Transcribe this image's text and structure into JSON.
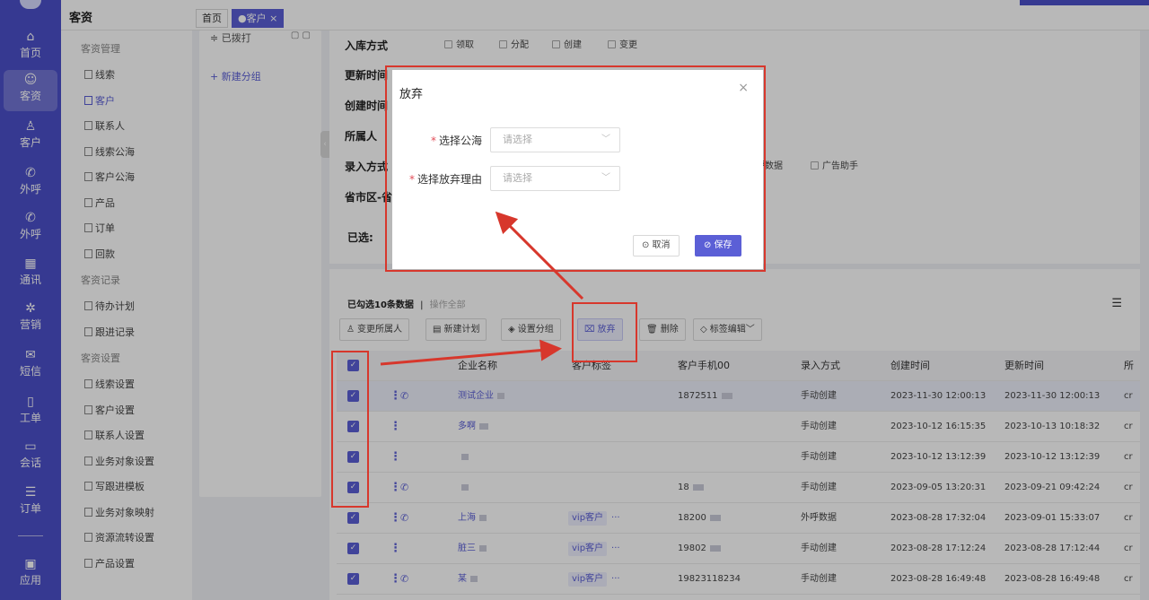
{
  "rail": [
    {
      "label": "首页",
      "icon": "home-icon",
      "glyph": "⌂"
    },
    {
      "label": "客资",
      "icon": "users-icon",
      "glyph": "☺"
    },
    {
      "label": "客户",
      "icon": "person-icon",
      "glyph": "♙"
    },
    {
      "label": "外呼",
      "icon": "phone-out-icon",
      "glyph": "✆"
    },
    {
      "label": "外呼",
      "icon": "phone-out-icon",
      "glyph": "✆"
    },
    {
      "label": "通讯",
      "icon": "contacts-icon",
      "glyph": "▦"
    },
    {
      "label": "营销",
      "icon": "marketing-icon",
      "glyph": "✲"
    },
    {
      "label": "短信",
      "icon": "sms-icon",
      "glyph": "✉"
    },
    {
      "label": "工单",
      "icon": "ticket-icon",
      "glyph": "▯"
    },
    {
      "label": "会话",
      "icon": "chat-icon",
      "glyph": "▭"
    },
    {
      "label": "订单",
      "icon": "order-icon",
      "glyph": "☰"
    },
    {
      "label": "应用",
      "icon": "apps-icon",
      "glyph": "▣"
    }
  ],
  "topbar": {
    "module_title": "客资",
    "tabs": [
      "首页",
      "●客户 ×"
    ]
  },
  "subnav": {
    "groups": [
      {
        "title": "客资管理",
        "items": [
          "线索",
          "客户",
          "联系人",
          "线索公海",
          "客户公海",
          "产品",
          "订单",
          "回款"
        ]
      },
      {
        "title": "客资记录",
        "items": [
          "待办计划",
          "跟进记录"
        ]
      },
      {
        "title": "客资设置",
        "items": [
          "线索设置",
          "客户设置",
          "联系人设置",
          "业务对象设置",
          "写跟进模板",
          "业务对象映射",
          "资源流转设置",
          "产品设置"
        ]
      }
    ],
    "active": "客户"
  },
  "groups_panel": {
    "top_item": "≑ 已拨打",
    "top_icons": "▢ ▢",
    "new_group": "+ 新建分组"
  },
  "filters": {
    "rows": [
      {
        "label": "入库方式",
        "options": [
          "领取",
          "分配",
          "创建",
          "变更"
        ]
      },
      {
        "label": "更新时间",
        "options": []
      },
      {
        "label": "创建时间",
        "options": []
      },
      {
        "label": "所属人",
        "options": []
      },
      {
        "label": "录入方式",
        "options": [
          "呼数据",
          "广告助手"
        ]
      },
      {
        "label": "省市区-省",
        "options": []
      },
      {
        "label": "已选:",
        "options": []
      }
    ]
  },
  "list": {
    "selected_info": "已勾选10条数据",
    "divider": "|",
    "operate_all": "操作全部",
    "toolbar": [
      {
        "label": "变更所属人",
        "icon": "user-change-icon",
        "glyph": "♙"
      },
      {
        "label": "新建计划",
        "icon": "plan-icon",
        "glyph": "▤"
      },
      {
        "label": "设置分组",
        "icon": "layers-icon",
        "glyph": "◈"
      },
      {
        "label": "放弃",
        "icon": "abandon-icon",
        "glyph": "⌧"
      },
      {
        "label": "删除",
        "icon": "trash-icon",
        "glyph": "🗑"
      },
      {
        "label": "标签编辑﹀",
        "icon": "tag-icon",
        "glyph": "◇"
      }
    ],
    "columns": [
      "企业名称",
      "客户标签",
      "客户手机00",
      "录入方式",
      "创建时间",
      "更新时间",
      "所"
    ],
    "rows": [
      {
        "name": "测试企业",
        "tag": "",
        "phone": "1872511",
        "entry": "手动创建",
        "created": "2023-11-30 12:00:13",
        "updated": "2023-11-30 12:00:13",
        "owner": "cr",
        "call": true
      },
      {
        "name": "多啊",
        "tag": "",
        "phone": "",
        "entry": "手动创建",
        "created": "2023-10-12 16:15:35",
        "updated": "2023-10-13 10:18:32",
        "owner": "cr",
        "call": false
      },
      {
        "name": "",
        "tag": "",
        "phone": "",
        "entry": "手动创建",
        "created": "2023-10-12 13:12:39",
        "updated": "2023-10-12 13:12:39",
        "owner": "cr",
        "call": false
      },
      {
        "name": "",
        "tag": "",
        "phone": "18",
        "entry": "手动创建",
        "created": "2023-09-05 13:20:31",
        "updated": "2023-09-21 09:42:24",
        "owner": "cr",
        "call": true
      },
      {
        "name": "上海",
        "tag": "vip客户",
        "phone": "18200",
        "entry": "外呼数据",
        "created": "2023-08-28 17:32:04",
        "updated": "2023-09-01 15:33:07",
        "owner": "cr",
        "call": true
      },
      {
        "name": "脏三",
        "tag": "vip客户",
        "phone": "19802",
        "entry": "手动创建",
        "created": "2023-08-28 17:12:24",
        "updated": "2023-08-28 17:12:44",
        "owner": "cr",
        "call": false
      },
      {
        "name": "某",
        "tag": "vip客户",
        "phone": "19823118234",
        "entry": "手动创建",
        "created": "2023-08-28 16:49:48",
        "updated": "2023-08-28 16:49:48",
        "owner": "cr",
        "call": true
      }
    ],
    "more_glyph": "···"
  },
  "modal": {
    "title": "放弃",
    "close": "×",
    "fields": [
      {
        "label": "选择公海",
        "placeholder": "请选择"
      },
      {
        "label": "选择放弃理由",
        "placeholder": "请选择"
      }
    ],
    "required_mark": "*",
    "cancel": "⊙ 取消",
    "save": "⊘ 保存"
  },
  "colors": {
    "brand": "#4b4fc9",
    "accent": "#5b5fd6",
    "annotation": "#d7372c"
  }
}
